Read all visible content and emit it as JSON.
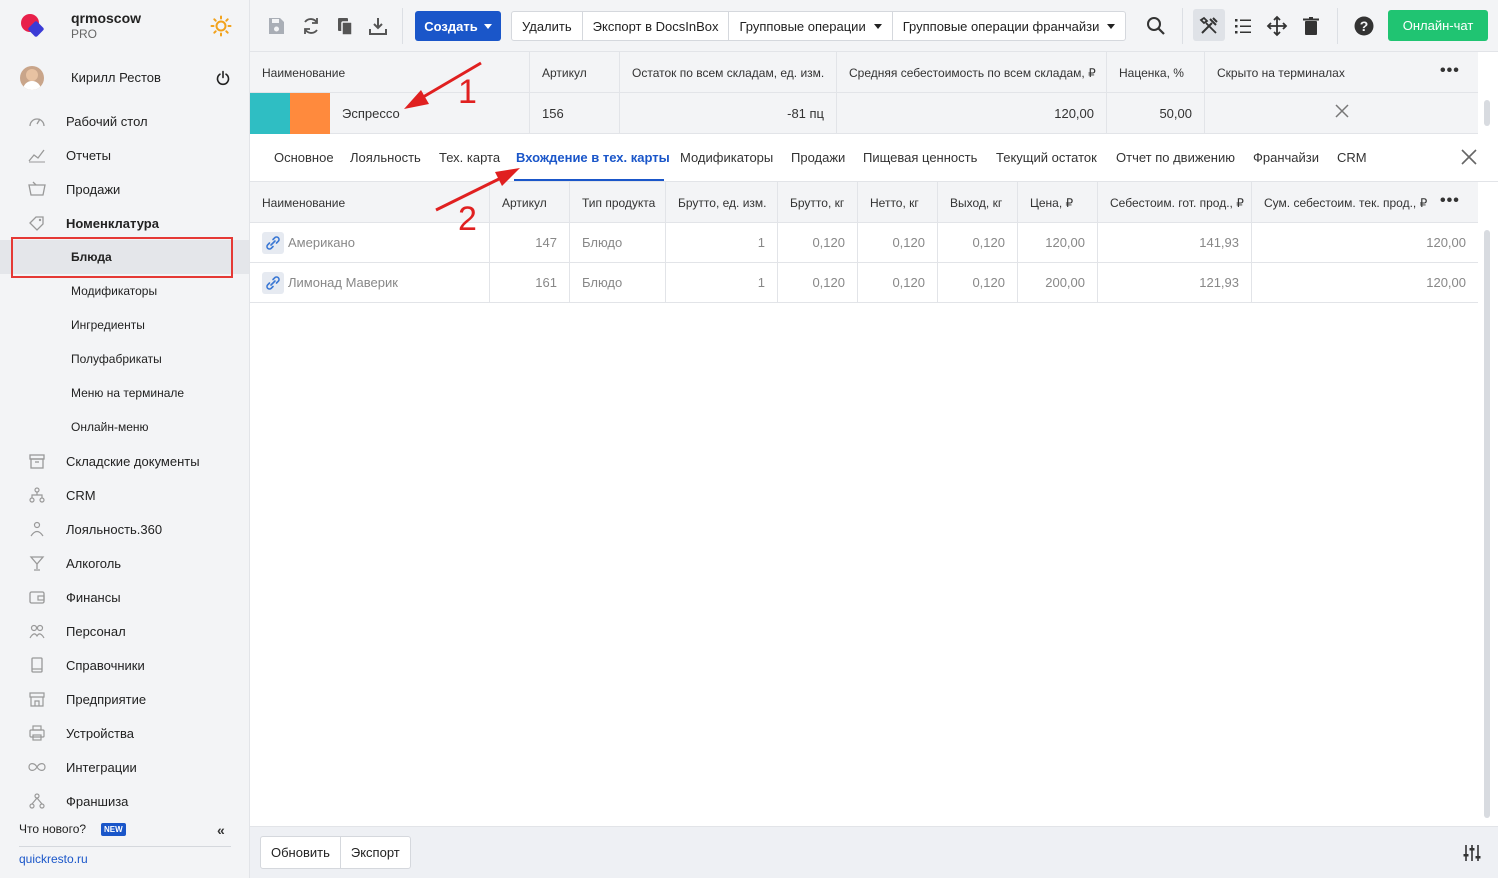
{
  "brand": {
    "name": "qrmoscow",
    "plan": "PRO"
  },
  "user": {
    "name": "Кирилл Рестов"
  },
  "nav": [
    {
      "label": "Рабочий стол",
      "icon": "dashboard-icon"
    },
    {
      "label": "Отчеты",
      "icon": "reports-icon"
    },
    {
      "label": "Продажи",
      "icon": "sales-icon"
    },
    {
      "label": "Номенклатура",
      "icon": "tag-icon"
    },
    {
      "label": "Блюда",
      "icon": ""
    },
    {
      "label": "Модификаторы",
      "icon": ""
    },
    {
      "label": "Ингредиенты",
      "icon": ""
    },
    {
      "label": "Полуфабрикаты",
      "icon": ""
    },
    {
      "label": "Меню на терминале",
      "icon": ""
    },
    {
      "label": "Онлайн-меню",
      "icon": ""
    },
    {
      "label": "Складские документы",
      "icon": "warehouse-icon"
    },
    {
      "label": "CRM",
      "icon": "crm-icon"
    },
    {
      "label": "Лояльность.360",
      "icon": "loyalty-icon"
    },
    {
      "label": "Алкоголь",
      "icon": "alcohol-icon"
    },
    {
      "label": "Финансы",
      "icon": "wallet-icon"
    },
    {
      "label": "Персонал",
      "icon": "staff-icon"
    },
    {
      "label": "Справочники",
      "icon": "book-icon"
    },
    {
      "label": "Предприятие",
      "icon": "store-icon"
    },
    {
      "label": "Устройства",
      "icon": "printer-icon"
    },
    {
      "label": "Интеграции",
      "icon": "infinity-icon"
    },
    {
      "label": "Франшиза",
      "icon": "franchise-icon"
    }
  ],
  "sidebar_footer": {
    "whats_new": "Что нового?",
    "new_badge": "NEW",
    "site": "quickresto.ru"
  },
  "toolbar": {
    "create": "Создать",
    "delete": "Удалить",
    "export_docsinbox": "Экспорт в DocsInBox",
    "group_ops": "Групповые операции",
    "group_ops_franchise": "Групповые операции франчайзи",
    "online_chat": "Онлайн-чат"
  },
  "main_table": {
    "headers": [
      "Наименование",
      "Артикул",
      "Остаток по всем складам, ед. изм.",
      "Средняя себестоимость по всем складам, ₽",
      "Наценка, %",
      "Скрыто на терминалах"
    ],
    "row": {
      "name": "Эспрессо",
      "article": "156",
      "stock": "-81 пц",
      "cost": "120,00",
      "markup": "50,00"
    }
  },
  "tabs": [
    "Основное",
    "Лояльность",
    "Тех. карта",
    "Вхождение в тех. карты",
    "Модификаторы",
    "Продажи",
    "Пищевая ценность",
    "Текущий остаток",
    "Отчет по движению",
    "Франчайзи",
    "CRM"
  ],
  "detail_table": {
    "headers": [
      "Наименование",
      "Артикул",
      "Тип продукта",
      "Брутто, ед. изм.",
      "Брутто, кг",
      "Нетто, кг",
      "Выход, кг",
      "Цена, ₽",
      "Себестоим. гот. прод., ₽",
      "Сум. себестоим. тек. прод., ₽"
    ],
    "rows": [
      [
        "Американо",
        "147",
        "Блюдо",
        "1",
        "0,120",
        "0,120",
        "0,120",
        "120,00",
        "141,93",
        "120,00"
      ],
      [
        "Лимонад Маверик",
        "161",
        "Блюдо",
        "1",
        "0,120",
        "0,120",
        "0,120",
        "200,00",
        "121,93",
        "120,00"
      ]
    ]
  },
  "footer": {
    "refresh": "Обновить",
    "export": "Экспорт"
  },
  "annotations": [
    "1",
    "2"
  ],
  "colors": {
    "accent": "#1a56c9",
    "chat": "#20c472",
    "swatch1": "#2fbec3",
    "swatch2": "#ff8a3d",
    "annotation": "#e02020"
  }
}
